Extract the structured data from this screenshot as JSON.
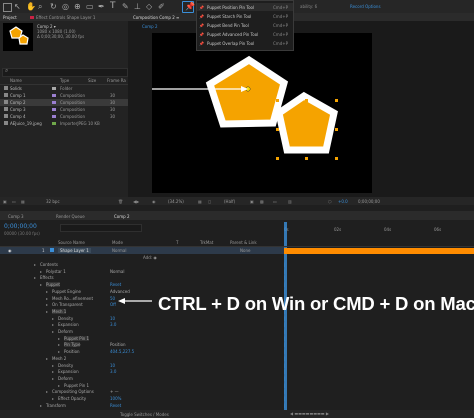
{
  "colors": {
    "accent": "#3a8fd9",
    "shape_fill": "#f5a300",
    "bg": "#1c1c1c",
    "timeline_bar": "#ff8c00"
  },
  "tools_menu": {
    "items": [
      {
        "label": "Puppet Position Pin Tool",
        "shortcut": "Cmd+P",
        "selected": true
      },
      {
        "label": "Puppet Starch Pin Tool",
        "shortcut": "Cmd+P"
      },
      {
        "label": "Puppet Bend Pin Tool",
        "shortcut": "Cmd+P"
      },
      {
        "label": "Puppet Advanced Pin Tool",
        "shortcut": "Cmd+P"
      },
      {
        "label": "Puppet Overlap Pin Tool",
        "shortcut": "Cmd+P"
      }
    ]
  },
  "toolbar": {
    "extra_label": "ability: 6",
    "record_label": "Record Options"
  },
  "project_panel": {
    "tab_project": "Project",
    "tab_effect_controls": "Effect Controls  Shape Layer 1",
    "comp_name": "Comp 2 ▾",
    "comp_info": [
      "1080 x 1080 (1.00)",
      "Δ 0;00;30;00, 30.00 fps"
    ],
    "columns": [
      "Name",
      "Type",
      "Size",
      "Frame Ra"
    ],
    "rows": [
      {
        "name": "Solids",
        "type": "Folder",
        "size": "",
        "fps": ""
      },
      {
        "name": "Comp 1",
        "type": "Composition",
        "size": "",
        "fps": "30"
      },
      {
        "name": "Comp 2",
        "type": "Composition",
        "size": "",
        "fps": "30",
        "selected": true
      },
      {
        "name": "Comp 3",
        "type": "Composition",
        "size": "",
        "fps": "30"
      },
      {
        "name": "Comp 4",
        "type": "Composition",
        "size": "",
        "fps": "30"
      },
      {
        "name": "AEJuice_19.jpeg",
        "type": "ImporterJPEG",
        "size": "10 KB",
        "fps": ""
      }
    ],
    "bpc": "32 bpc"
  },
  "comp_panel": {
    "tab": "Composition Comp 2 ≡",
    "subtab": "Comp 2",
    "zoom": "(34.2%)",
    "resolution": "(Half)",
    "exposure": "+0.0",
    "timecode": "0;00;00;00"
  },
  "timeline": {
    "tabs": [
      "Comp 3",
      "Render Queue",
      "Comp 2"
    ],
    "active_tab": "Comp 2",
    "timecode": "0;00;00;00",
    "fps_note": "00000 (30.00 fps)",
    "ruler": [
      "0s",
      "02s",
      "04s",
      "06s",
      "08s"
    ],
    "columns": [
      "Source Name",
      "Mode",
      "T",
      "TrkMat",
      "Parent & Link"
    ],
    "layer": {
      "num": "1",
      "name": "Shape Layer 1",
      "mode": "Normal",
      "parent": "None"
    },
    "add_label": "Add: ◉",
    "properties": [
      {
        "label": "Contents",
        "indent": 1
      },
      {
        "label": "Polystar 1",
        "indent": 2,
        "value": "Normal"
      },
      {
        "label": "Effects",
        "indent": 1
      },
      {
        "label": "Puppet",
        "indent": 2,
        "value": "Reset"
      },
      {
        "label": "Puppet Engine",
        "indent": 3,
        "value": "Advanced"
      },
      {
        "label": "Mesh Ro...efinement",
        "indent": 3,
        "value": "50"
      },
      {
        "label": "On Transparent",
        "indent": 3,
        "value": "Off"
      },
      {
        "label": "Mesh 1",
        "indent": 3
      },
      {
        "label": "Density",
        "indent": 4,
        "value": "10"
      },
      {
        "label": "Expansion",
        "indent": 4,
        "value": "3.0"
      },
      {
        "label": "Deform",
        "indent": 4
      },
      {
        "label": "Puppet Pin 1",
        "indent": 5
      },
      {
        "label": "Pin Type",
        "indent": 5,
        "value": "Position"
      },
      {
        "label": "Position",
        "indent": 5,
        "value": "404.5,227.5"
      },
      {
        "label": "Mesh 2",
        "indent": 3
      },
      {
        "label": "Density",
        "indent": 4,
        "value": "10"
      },
      {
        "label": "Expansion",
        "indent": 4,
        "value": "3.0"
      },
      {
        "label": "Deform",
        "indent": 4
      },
      {
        "label": "Puppet Pin 1",
        "indent": 5
      },
      {
        "label": "Compositing Options",
        "indent": 3,
        "value": "+ —"
      },
      {
        "label": "Effect Opacity",
        "indent": 4,
        "value": "100%"
      },
      {
        "label": "Transform",
        "indent": 2,
        "value": "Reset"
      }
    ],
    "footer": "Toggle Switches / Modes"
  },
  "annotation": "CTRL + D on Win or CMD + D on Mac"
}
